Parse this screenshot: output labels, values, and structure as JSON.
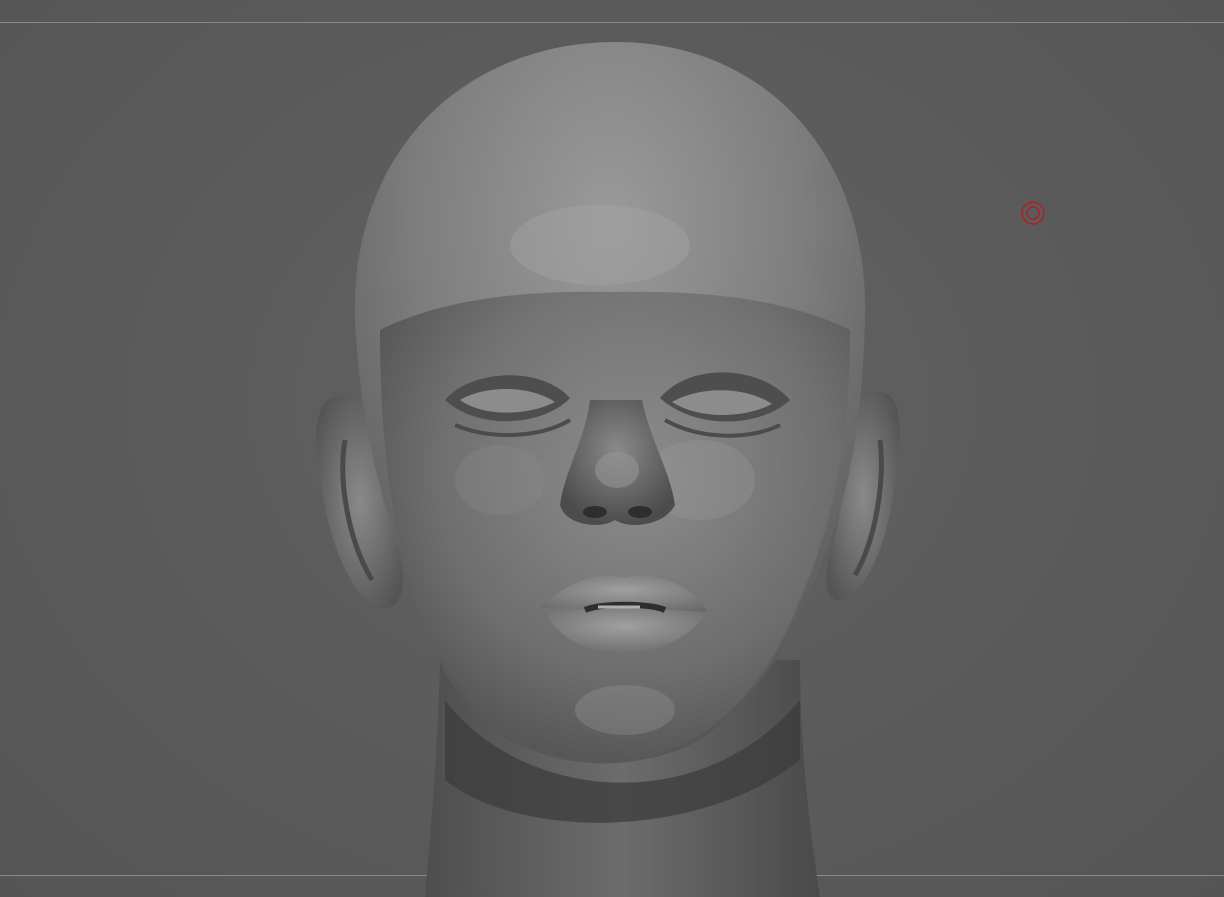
{
  "viewport": {
    "background_color": "#5a5a5a",
    "guide_line_color": "#8a8a8a",
    "model": "head-bust-sculpt",
    "material_color": "#7a7a7a"
  },
  "pivot_marker": {
    "icon": "target-icon",
    "color": "#b02020"
  }
}
